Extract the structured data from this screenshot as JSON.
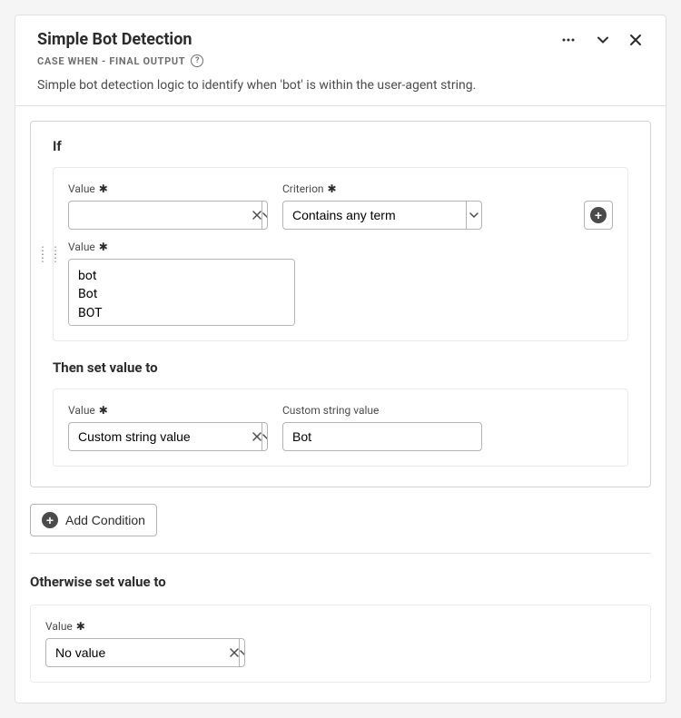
{
  "header": {
    "title": "Simple Bot Detection",
    "subtitle": "CASE WHEN - FINAL OUTPUT",
    "description": "Simple bot detection logic to identify when 'bot' is within the user-agent string."
  },
  "if": {
    "label": "If",
    "value_field": {
      "label": "Value",
      "value": ""
    },
    "criterion_field": {
      "label": "Criterion",
      "value": "Contains any term"
    },
    "terms_field": {
      "label": "Value",
      "value": "bot\nBot\nBOT"
    }
  },
  "then": {
    "label": "Then set value to",
    "value_field": {
      "label": "Value",
      "value": "Custom string value"
    },
    "custom_field": {
      "label": "Custom string value",
      "value": "Bot"
    }
  },
  "add_condition_label": "Add Condition",
  "otherwise": {
    "label": "Otherwise set value to",
    "value_field": {
      "label": "Value",
      "value": "No value"
    }
  }
}
